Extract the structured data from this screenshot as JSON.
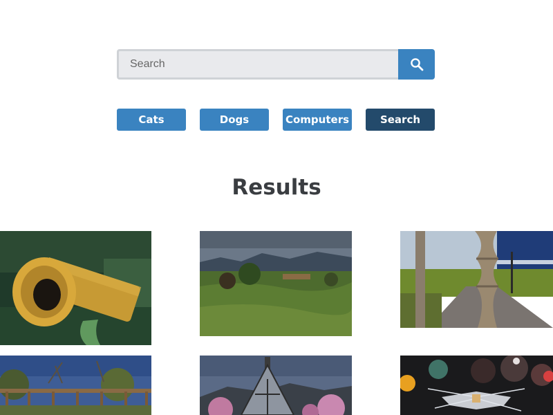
{
  "search": {
    "placeholder": "Search",
    "value": "",
    "submit_icon": "search-icon"
  },
  "categories": [
    {
      "label": "Cats"
    },
    {
      "label": "Dogs"
    },
    {
      "label": "Computers"
    },
    {
      "label": "Search"
    }
  ],
  "results": {
    "heading": "Results"
  },
  "colors": {
    "accent": "#3a83c0",
    "accent_dark": "#234a6b",
    "heading": "#3a3d41",
    "input_bg": "#e9eaed"
  }
}
